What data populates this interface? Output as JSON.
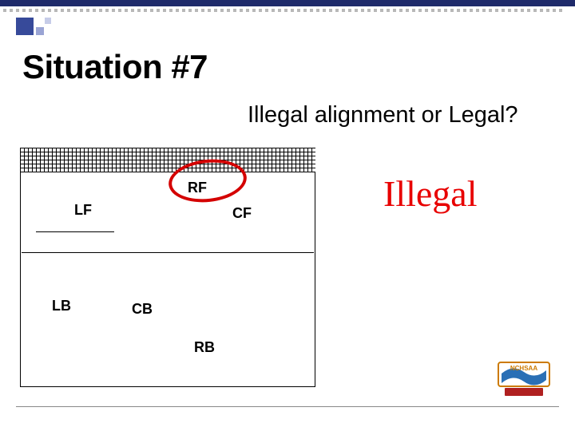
{
  "slide": {
    "title": "Situation #7",
    "question": "Illegal alignment or Legal?",
    "verdict": "Illegal"
  },
  "positions": {
    "rf": "RF",
    "lf": "LF",
    "cf": "CF",
    "lb": "LB",
    "cb": "CB",
    "rb": "RB"
  }
}
